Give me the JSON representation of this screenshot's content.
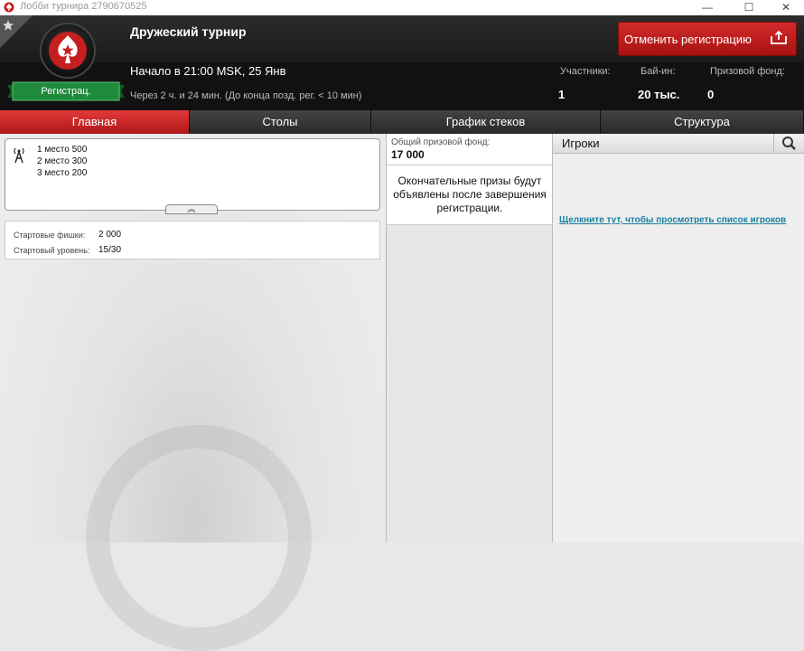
{
  "window": {
    "title": "Лобби турнира 2790670525",
    "controls": [
      "minimize",
      "maximize",
      "close"
    ]
  },
  "header": {
    "tournament_name": "Дружеский турнир",
    "start_time": "Начало в 21:00 MSK, 25 Янв",
    "time_left": "Через 2 ч. и 24 мин. (До конца позд. рег. < 10 мин)",
    "registered_badge": "Регистрац.",
    "cancel_button": "Отменить регистрацию",
    "stats": {
      "players_label": "Участники:",
      "players_value": "1",
      "buyin_label": "Бай-ин:",
      "buyin_value": "20 тыс.",
      "prizepool_label": "Призовой фонд:",
      "prizepool_value": "0"
    }
  },
  "tabs": [
    {
      "label": "Главная",
      "active": true
    },
    {
      "label": "Столы",
      "active": false
    },
    {
      "label": "График стеков",
      "active": false
    },
    {
      "label": "Структура",
      "active": false
    }
  ],
  "prizes": [
    "1 место 500",
    "2 место 300",
    "3 место 200"
  ],
  "info": {
    "starting_chips_label": "Стартовые фишки:",
    "starting_chips_value": "2 000",
    "starting_level_label": "Стартовый уровень:",
    "starting_level_value": "15/30"
  },
  "prize_pool": {
    "label": "Общий призовой фонд:",
    "value": "17 000",
    "note": "Окончательные призы будут объявлены после завершения регистрации."
  },
  "players": {
    "title": "Игроки",
    "link": "Щелкните тут, чтобы просмотреть список игроков"
  },
  "colors": {
    "accent_red": "#c61f1f",
    "registered_green": "#1f8a3a",
    "link_teal": "#1a7fa0"
  },
  "icons": [
    "pokerstars-logo-icon",
    "star-icon",
    "cancel-registration-icon",
    "prize-tower-icon",
    "expand-chevron-icon",
    "search-icon"
  ]
}
